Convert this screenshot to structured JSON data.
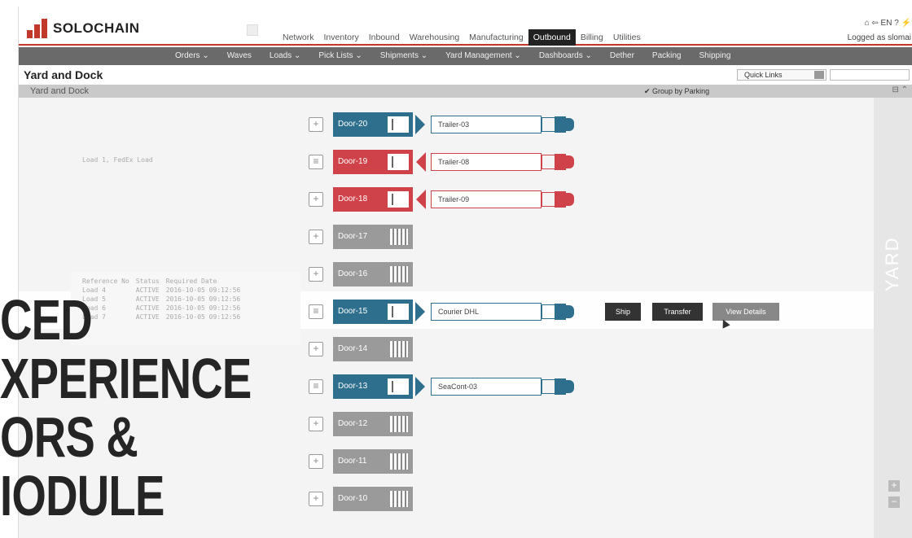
{
  "header": {
    "logo_text": "SOLOCHAIN",
    "nav": [
      "Network",
      "Inventory",
      "Inbound",
      "Warehousing",
      "Manufacturing",
      "Outbound",
      "Billing",
      "Utilities"
    ],
    "active_nav": "Outbound",
    "top_icons": "⌂ ⇦ EN ? ⚡",
    "user_text": "Logged as slomai"
  },
  "subnav": [
    "Orders ⌄",
    "Waves",
    "Loads ⌄",
    "Pick Lists ⌄",
    "Shipments ⌄",
    "Yard Management ⌄",
    "Dashboards ⌄",
    "Dether",
    "Packing",
    "Shipping"
  ],
  "page": {
    "title": "Yard and Dock",
    "quick_links": "Quick Links",
    "panel_title": "Yard and Dock",
    "group_by": "✔ Group by Parking",
    "panel_icons": "⊟ ⌃",
    "yard_label": "YARD"
  },
  "load_text": "Load 1, FedEx Load",
  "ref_table": {
    "headers": [
      "Reference No",
      "Status",
      "Required Date"
    ],
    "rows": [
      [
        "Load 4",
        "ACTIVE",
        "2016-10-05 09:12:56"
      ],
      [
        "Load 5",
        "ACTIVE",
        "2016-10-05 09:12:56"
      ],
      [
        "Load 6",
        "ACTIVE",
        "2016-10-05 09:12:56"
      ],
      [
        "Load 7",
        "ACTIVE",
        "2016-10-05 09:12:56"
      ]
    ]
  },
  "doors": [
    {
      "label": "Door-20",
      "state": "blue",
      "icon": "add",
      "trailer": "Trailer-03"
    },
    {
      "label": "Door-19",
      "state": "red",
      "icon": "list",
      "trailer": "Trailer-08"
    },
    {
      "label": "Door-18",
      "state": "red",
      "icon": "add",
      "trailer": "Trailer-09"
    },
    {
      "label": "Door-17",
      "state": "gray",
      "icon": "add",
      "trailer": ""
    },
    {
      "label": "Door-16",
      "state": "gray",
      "icon": "add",
      "trailer": ""
    },
    {
      "label": "Door-15",
      "state": "blue",
      "icon": "list",
      "trailer": "Courier DHL"
    },
    {
      "label": "Door-14",
      "state": "gray",
      "icon": "add",
      "trailer": ""
    },
    {
      "label": "Door-13",
      "state": "blue",
      "icon": "list",
      "trailer": "SeaCont-03"
    },
    {
      "label": "Door-12",
      "state": "gray",
      "icon": "add",
      "trailer": ""
    },
    {
      "label": "Door-11",
      "state": "gray",
      "icon": "add",
      "trailer": ""
    },
    {
      "label": "Door-10",
      "state": "gray",
      "icon": "add",
      "trailer": ""
    }
  ],
  "actions": {
    "ship": "Ship",
    "transfer": "Transfer",
    "view_details": "View Details"
  },
  "zoom": {
    "plus": "+",
    "minus": "−"
  },
  "overlay_lines": [
    "CED",
    "XPERIENCE",
    "ORS &",
    "IODULE"
  ],
  "colors": {
    "blue": "#2e6f8e",
    "red": "#d0424a",
    "gray": "#9a9a9a",
    "accent": "#c0392b"
  }
}
